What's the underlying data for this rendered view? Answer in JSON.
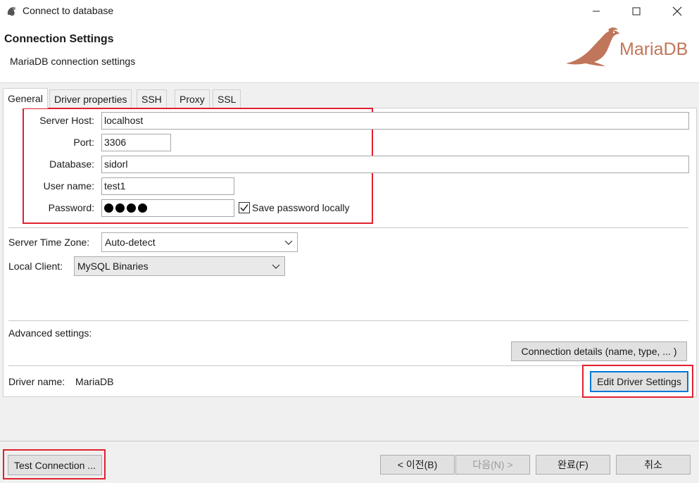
{
  "window": {
    "title": "Connect to database"
  },
  "header": {
    "title": "Connection Settings",
    "subtitle": "MariaDB connection settings",
    "logo_text": "MariaDB",
    "logo_color": "#c0765a"
  },
  "tabs": [
    {
      "label": "General",
      "active": true
    },
    {
      "label": "Driver properties",
      "active": false
    },
    {
      "label": "SSH",
      "active": false
    },
    {
      "label": "Proxy",
      "active": false
    },
    {
      "label": "SSL",
      "active": false
    }
  ],
  "connection": {
    "host_label": "Server Host:",
    "host_value": "localhost",
    "port_label": "Port:",
    "port_value": "3306",
    "database_label": "Database:",
    "database_value": "sidorl",
    "user_label": "User name:",
    "user_value": "test1",
    "password_label": "Password:",
    "password_masked_count": 4,
    "save_password_label": "Save password locally",
    "save_password_checked": true
  },
  "settings": {
    "timezone_label": "Server Time Zone:",
    "timezone_value": "Auto-detect",
    "local_client_label": "Local Client:",
    "local_client_value": "MySQL Binaries"
  },
  "advanced": {
    "label": "Advanced settings:",
    "details_button": "Connection details (name, type, ... )"
  },
  "driver": {
    "name_label": "Driver name:",
    "name_value": "MariaDB",
    "edit_button": "Edit Driver Settings"
  },
  "footer": {
    "test_button": "Test Connection ...",
    "prev_button": "< 이전(B)",
    "next_button": "다음(N) >",
    "finish_button": "완료(F)",
    "cancel_button": "취소"
  },
  "colors": {
    "highlight_box": "#e0202e",
    "focus_border": "#0078d7"
  }
}
